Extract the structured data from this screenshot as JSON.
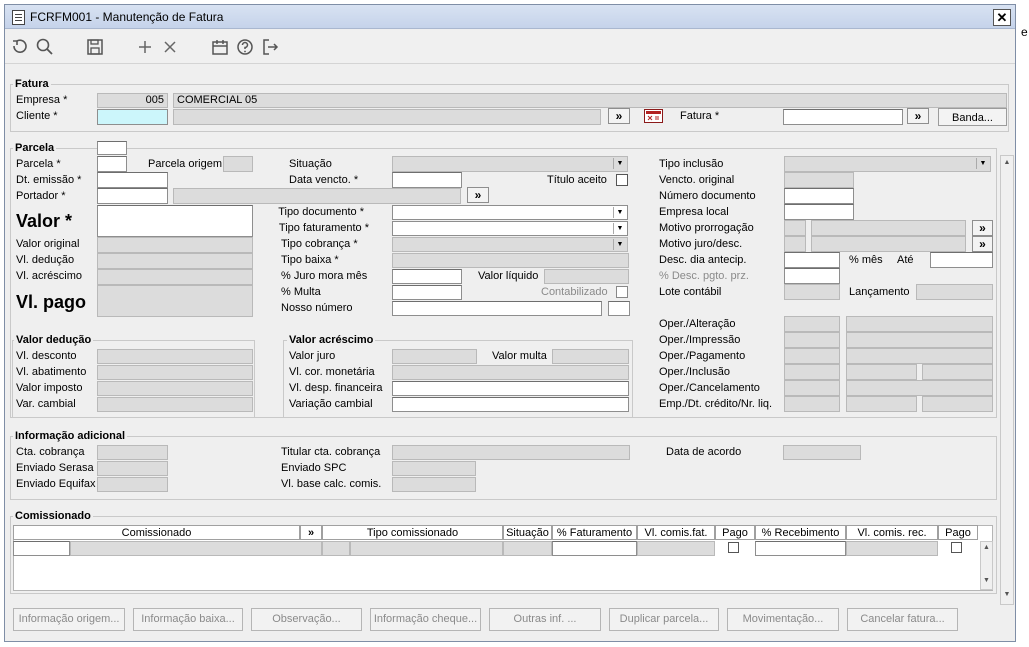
{
  "window": {
    "title": "FCRFM001 - Manutenção de Fatura",
    "close": "✕",
    "edge_char": "e"
  },
  "toolbar_icons": [
    "refresh-icon",
    "search-icon",
    "save-icon",
    "add-icon",
    "delete-icon",
    "calendar-icon",
    "help-icon",
    "exit-icon"
  ],
  "fatura": {
    "section": "Fatura",
    "empresa_label": "Empresa *",
    "empresa_code": "005",
    "empresa_name": "COMERCIAL 05",
    "cliente_label": "Cliente *",
    "cliente_value": "",
    "lookup": "»",
    "fatura_label": "Fatura *",
    "fatura_value": "",
    "banda_label": "Banda..."
  },
  "parcela": {
    "section": "Parcela",
    "parcela_label": "Parcela *",
    "parcela_origem_label": "Parcela origem",
    "dt_emissao_label": "Dt. emissão *",
    "portador_label": "Portador *",
    "valor_label": "Valor *",
    "valor_original_label": "Valor original",
    "vl_deducao_label": "Vl. dedução",
    "vl_acrescimo_label": "Vl. acréscimo",
    "vl_pago_label": "Vl. pago",
    "situacao_label": "Situação",
    "data_vencto_label": "Data vencto. *",
    "titulo_aceito_label": "Título aceito",
    "tipo_documento_label": "Tipo documento *",
    "tipo_faturamento_label": "Tipo faturamento *",
    "tipo_cobranca_label": "Tipo cobrança *",
    "tipo_baixa_label": "Tipo baixa *",
    "juro_mora_label": "% Juro mora mês",
    "valor_liquido_label": "Valor líquido",
    "multa_label": "% Multa",
    "contabilizado_label": "Contabilizado",
    "nosso_numero_label": "Nosso número",
    "tipo_inclusao_label": "Tipo inclusão",
    "vencto_original_label": "Vencto. original",
    "numero_documento_label": "Número documento",
    "empresa_local_label": "Empresa local",
    "motivo_prorrogacao_label": "Motivo prorrogação",
    "motivo_juro_label": "Motivo juro/desc.",
    "desc_dia_antecip_label": "Desc. dia antecip.",
    "pct_mes_label": "% mês",
    "ate_label": "Até",
    "desc_pgto_label": "% Desc. pgto. prz.",
    "lote_contabil_label": "Lote contábil",
    "lancamento_label": "Lançamento",
    "oper_alteracao_label": "Oper./Alteração",
    "oper_impressao_label": "Oper./Impressão",
    "oper_pagamento_label": "Oper./Pagamento",
    "oper_inclusao_label": "Oper./Inclusão",
    "oper_cancelamento_label": "Oper./Cancelamento",
    "emp_dt_credito_label": "Emp./Dt. crédito/Nr. liq."
  },
  "valor_deducao": {
    "section": "Valor dedução",
    "desconto_label": "Vl. desconto",
    "abatimento_label": "Vl. abatimento",
    "imposto_label": "Valor imposto",
    "cambial_label": "Var. cambial"
  },
  "valor_acrescimo": {
    "section": "Valor acréscimo",
    "juro_label": "Valor juro",
    "multa_label": "Valor multa",
    "cor_monetaria_label": "Vl. cor. monetária",
    "desp_financeira_label": "Vl. desp. financeira",
    "variacao_cambial_label": "Variação cambial"
  },
  "informacao_adicional": {
    "section": "Informação adicional",
    "cta_cobranca_label": "Cta. cobrança",
    "enviado_serasa_label": "Enviado Serasa",
    "enviado_equifax_label": "Enviado Equifax",
    "titular_cta_label": "Titular cta. cobrança",
    "enviado_spc_label": "Enviado SPC",
    "vl_base_comis_label": "Vl. base calc. comis.",
    "data_acordo_label": "Data de acordo"
  },
  "comissionado": {
    "section": "Comissionado",
    "columns": [
      "Comissionado",
      "»",
      "Tipo comissionado",
      "Situação",
      "% Faturamento",
      "Vl. comis.fat.",
      "Pago",
      "% Recebimento",
      "Vl. comis. rec.",
      "Pago"
    ]
  },
  "footer_buttons": [
    "Informação origem...",
    "Informação baixa...",
    "Observação...",
    "Informação cheque...",
    "Outras inf. ...",
    "Duplicar parcela...",
    "Movimentação...",
    "Cancelar fatura..."
  ]
}
